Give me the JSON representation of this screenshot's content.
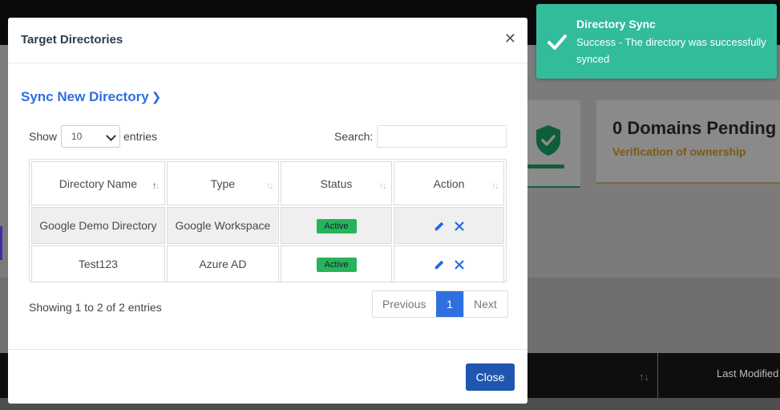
{
  "background": {
    "card_shield_icon": "shield-check-icon",
    "domains_pending_title": "0 Domains Pending",
    "domains_pending_sub": "Verification of ownership",
    "table_last_col": "Last Modified"
  },
  "modal": {
    "title": "Target Directories",
    "close_icon": "close-icon",
    "sync_new_link": "Sync New Directory",
    "show_label": "Show",
    "entries_value": "10",
    "entries_label": "entries",
    "search_label": "Search:",
    "search_value": "",
    "table": {
      "headers": [
        "Directory Name",
        "Type",
        "Status",
        "Action"
      ],
      "rows": [
        {
          "name": "Google Demo Directory",
          "type": "Google Workspace",
          "status": "Active"
        },
        {
          "name": "Test123",
          "type": "Azure AD",
          "status": "Active"
        }
      ]
    },
    "showing_text": "Showing 1 to 2 of 2 entries",
    "pagination": {
      "previous": "Previous",
      "current": "1",
      "next": "Next"
    },
    "close_button": "Close"
  },
  "toast": {
    "title": "Directory Sync",
    "message": "Success - The directory was successfully synced",
    "color": "#33bc9c"
  },
  "colors": {
    "accent": "#2f6fe0",
    "primary_button": "#1e56b0",
    "active_badge": "#27b35a"
  }
}
